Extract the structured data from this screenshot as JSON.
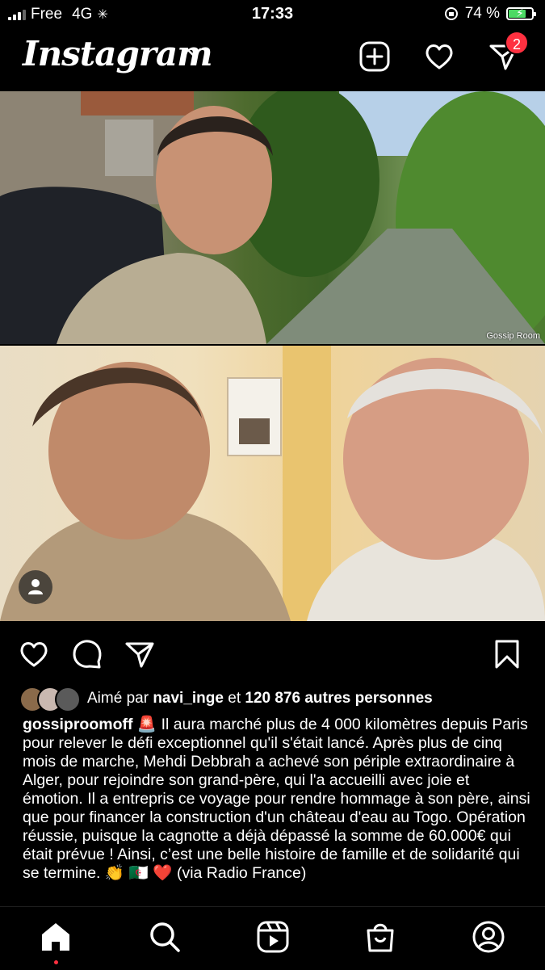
{
  "status_bar": {
    "carrier": "Free",
    "network": "4G",
    "time": "17:33",
    "battery": "74 %"
  },
  "header": {
    "logo": "Instagram",
    "icons": [
      "new-post-icon",
      "heart-icon",
      "direct-message-icon"
    ],
    "dm_badge": "2"
  },
  "post": {
    "photo_watermark": "Gossip Room",
    "liked_by_prefix": "Aimé par",
    "liked_by_user": "navi_inge",
    "liked_by_middle": "et",
    "liked_by_count": "120 876 autres personnes",
    "author": "gossiproomoff",
    "caption_text": "🚨 Il aura marché plus de 4 000 kilomètres depuis Paris pour relever le défi exceptionnel qu'il s'était lancé. Après plus de cinq mois de marche, Mehdi Debbrah a achevé son périple extraordinaire à Alger, pour rejoindre son grand-père, qui l'a accueilli avec joie et émotion. Il a entrepris ce voyage pour rendre hommage à son père, ainsi que pour financer la construction d'un château d'eau au Togo. Opération réussie, puisque la cagnotte a déjà dépassé la somme de 60.000€ qui était prévue ! Ainsi, c’est une belle histoire de famille et de solidarité qui se termine. 👏 🇩🇿 ❤️ (via Radio France)"
  },
  "tabbar": {
    "tabs": [
      "home-icon",
      "search-icon",
      "reels-icon",
      "shop-icon",
      "profile-icon"
    ],
    "active": "home-icon"
  },
  "colors": {
    "accent_red": "#ff3040",
    "background": "#000000",
    "battery_green": "#4cd964"
  }
}
